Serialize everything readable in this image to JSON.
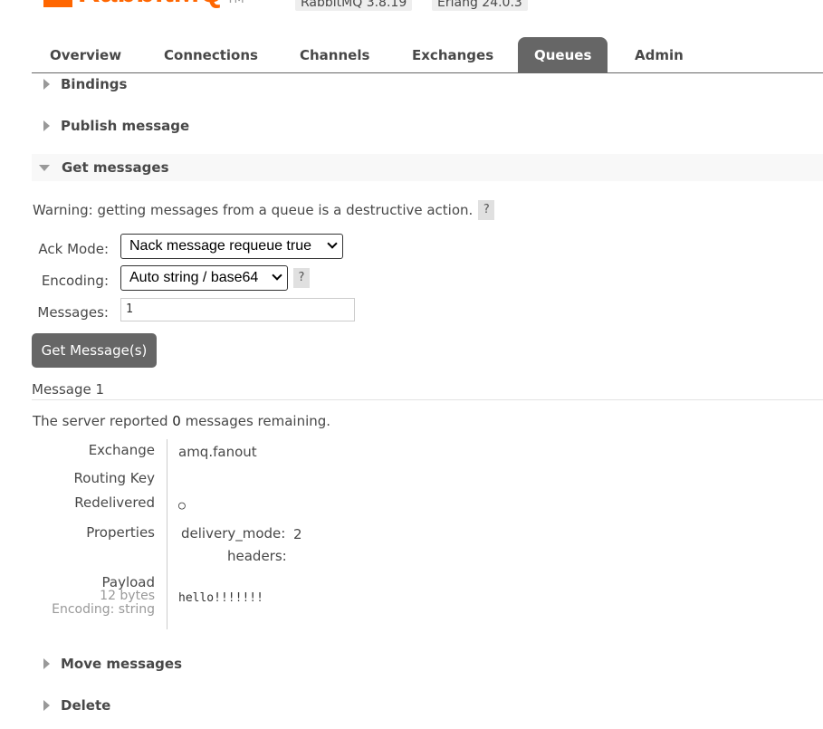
{
  "header": {
    "logo_text": "RabbitMQ",
    "logo_tm": "TM",
    "version": "RabbitMQ 3.8.19",
    "erlang": "Erlang 24.0.3"
  },
  "tabs": [
    "Overview",
    "Connections",
    "Channels",
    "Exchanges",
    "Queues",
    "Admin"
  ],
  "active_tab": "Queues",
  "sections": {
    "bindings": "Bindings",
    "publish": "Publish message",
    "get": "Get messages",
    "move": "Move messages",
    "delete": "Delete"
  },
  "get_messages": {
    "warning": "Warning: getting messages from a queue is a destructive action.",
    "help": "?",
    "ack_mode_label": "Ack Mode:",
    "ack_mode_value": "Nack message requeue true",
    "encoding_label": "Encoding:",
    "encoding_value": "Auto string / base64",
    "messages_label": "Messages:",
    "messages_value": "1",
    "button": "Get Message(s)"
  },
  "message": {
    "title": "Message 1",
    "server_prefix": "The server reported ",
    "server_count": "0",
    "server_suffix": " messages remaining.",
    "exchange_label": "Exchange",
    "exchange_value": "amq.fanout",
    "routing_key_label": "Routing Key",
    "redelivered_label": "Redelivered",
    "redelivered_value": "○",
    "properties_label": "Properties",
    "delivery_mode_label": "delivery_mode:",
    "delivery_mode_value": "2",
    "headers_label": "headers:",
    "payload_label": "Payload",
    "payload_bytes": "12 bytes",
    "payload_encoding": "Encoding: string",
    "payload_value": "hello!!!!!!!"
  },
  "colors": {
    "brand": "#ff6600",
    "tab_active_bg": "#666666",
    "button_bg": "#666666"
  }
}
